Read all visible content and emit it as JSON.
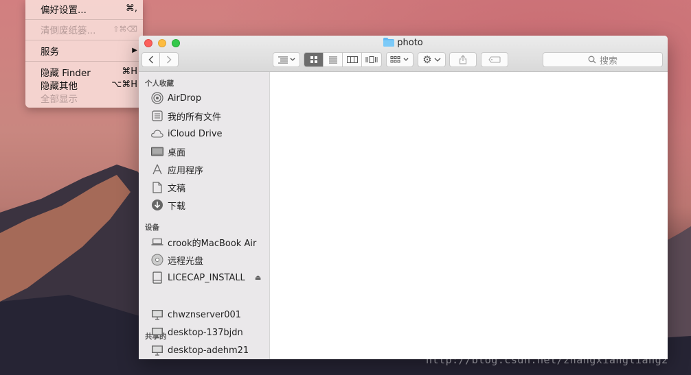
{
  "menu": {
    "items": [
      {
        "label": "偏好设置...",
        "shortcut": "⌘,",
        "disabled": false
      },
      {
        "label": "清倒废纸篓...",
        "shortcut": "⇧⌘⌫",
        "disabled": true
      },
      {
        "label": "服务",
        "shortcut": "▶",
        "disabled": false
      },
      {
        "label": "隐藏 Finder",
        "shortcut": "⌘H",
        "disabled": false
      },
      {
        "label": "隐藏其他",
        "shortcut": "⌥⌘H",
        "disabled": false
      },
      {
        "label": "全部显示",
        "shortcut": "",
        "disabled": true
      }
    ]
  },
  "window": {
    "title": "photo",
    "search_placeholder": "搜索",
    "sidebar": {
      "favorites_header": "个人收藏",
      "favorites": [
        {
          "label": "AirDrop",
          "icon": "airdrop-icon"
        },
        {
          "label": "我的所有文件",
          "icon": "all-files-icon"
        },
        {
          "label": "iCloud Drive",
          "icon": "cloud-icon"
        },
        {
          "label": "桌面",
          "icon": "desktop-icon"
        },
        {
          "label": "应用程序",
          "icon": "applications-icon"
        },
        {
          "label": "文稿",
          "icon": "documents-icon"
        },
        {
          "label": "下载",
          "icon": "download-icon"
        }
      ],
      "devices_header": "设备",
      "devices": [
        {
          "label": "crook的MacBook Air",
          "icon": "laptop-icon"
        },
        {
          "label": "远程光盘",
          "icon": "disc-icon"
        },
        {
          "label": "LICECAP_INSTALL",
          "icon": "drive-icon"
        }
      ],
      "shared_header": "共享的",
      "shared": [
        {
          "label": "chwznserver001",
          "icon": "monitor-icon"
        },
        {
          "label": "desktop-137bjdn",
          "icon": "monitor-icon"
        },
        {
          "label": "desktop-adehm21",
          "icon": "monitor-icon"
        }
      ]
    }
  },
  "watermark": "http://blog.csdn.net/zhangxiangliang2"
}
